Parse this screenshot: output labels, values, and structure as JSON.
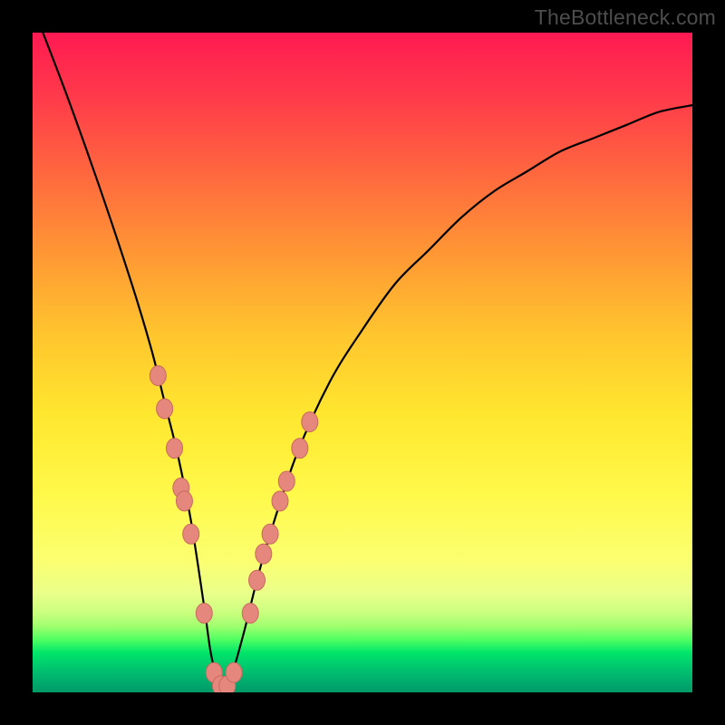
{
  "watermark": "TheBottleneck.com",
  "chart_data": {
    "type": "line",
    "title": "",
    "xlabel": "",
    "ylabel": "",
    "xlim": [
      0,
      100
    ],
    "ylim": [
      0,
      100
    ],
    "series": [
      {
        "name": "bottleneck-curve",
        "x": [
          0,
          5,
          10,
          15,
          18,
          20,
          22,
          24,
          26,
          27,
          28,
          29,
          30,
          32,
          34,
          36,
          40,
          45,
          50,
          55,
          60,
          65,
          70,
          75,
          80,
          85,
          90,
          95,
          100
        ],
        "y": [
          104,
          91,
          77,
          62,
          52,
          44,
          36,
          26,
          13,
          6,
          2,
          0,
          2,
          9,
          17,
          24,
          36,
          47,
          55,
          62,
          67,
          72,
          76,
          79,
          82,
          84,
          86,
          88,
          89
        ]
      }
    ],
    "markers": {
      "name": "highlight-points",
      "fill": "#e5877c",
      "stroke": "#c96a60",
      "points": [
        {
          "x": 19.0,
          "y": 48
        },
        {
          "x": 20.0,
          "y": 43
        },
        {
          "x": 21.5,
          "y": 37
        },
        {
          "x": 22.5,
          "y": 31
        },
        {
          "x": 23.0,
          "y": 29
        },
        {
          "x": 24.0,
          "y": 24
        },
        {
          "x": 26.0,
          "y": 12
        },
        {
          "x": 27.5,
          "y": 3
        },
        {
          "x": 28.5,
          "y": 1
        },
        {
          "x": 29.5,
          "y": 1
        },
        {
          "x": 30.5,
          "y": 3
        },
        {
          "x": 33.0,
          "y": 12
        },
        {
          "x": 34.0,
          "y": 17
        },
        {
          "x": 35.0,
          "y": 21
        },
        {
          "x": 36.0,
          "y": 24
        },
        {
          "x": 37.5,
          "y": 29
        },
        {
          "x": 38.5,
          "y": 32
        },
        {
          "x": 40.5,
          "y": 37
        },
        {
          "x": 42.0,
          "y": 41
        }
      ]
    },
    "gradient_stops": [
      {
        "pos": 0.0,
        "color": "#ff1a52"
      },
      {
        "pos": 0.5,
        "color": "#ffd82f"
      },
      {
        "pos": 0.8,
        "color": "#fbff70"
      },
      {
        "pos": 0.93,
        "color": "#2fff62"
      },
      {
        "pos": 1.0,
        "color": "#009a68"
      }
    ]
  }
}
